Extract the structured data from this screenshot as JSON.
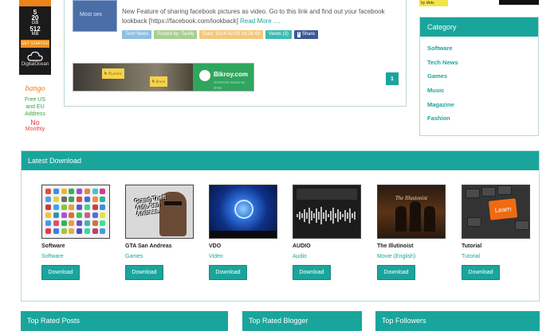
{
  "left_ad": {
    "do_specs": [
      "5",
      "20",
      "GB",
      "512",
      "MB"
    ],
    "do_button": "GET STARTED",
    "do_brand": "DigitalOcean",
    "bango_logo": "bango",
    "bango_lines": [
      "Free US",
      "and EU",
      "Address"
    ],
    "bango_big": "No",
    "bango_small": "Monthly"
  },
  "post": {
    "thumb_text": "Most sex",
    "excerpt": "New Feature of sharing facebook pictures as video. Go to this link and find out your facebook lookback [https://facebook.com/lookback]",
    "read_more": "Read More ....",
    "tags": {
      "category": "Tech News",
      "author": "Posted by: Taufiq",
      "date": "Date: 2014-02-05 16:28:49",
      "views": "Views (3)",
      "share": "Share",
      "share_icon": "f"
    },
    "bikroy": {
      "price1": "৳ ৩,০০০",
      "price2": "৳ ৫০০",
      "brand": "Bikroy.com",
      "tagline": "বাংলাদেশের সবচেয়ে বড় বাজার"
    },
    "page_number": "1"
  },
  "tads_label": "by tAds",
  "category": {
    "title": "Category",
    "items": [
      "Software",
      "Tech News",
      "Games",
      "Music",
      "Magazine",
      "Fashion"
    ]
  },
  "latest_download": {
    "title": "Latest Download",
    "button_label": "Download",
    "items": [
      {
        "title": "Software",
        "category": "Software"
      },
      {
        "title": "GTA San Andreas",
        "category": "Games"
      },
      {
        "title": "VDO",
        "category": "Video"
      },
      {
        "title": "AUDIO",
        "category": "Audio"
      },
      {
        "title": "The Illutinoist",
        "category": "Movie (English)"
      },
      {
        "title": "Tutorial",
        "category": "Tutorial"
      }
    ],
    "thumb_text": {
      "gta": "Grand Theft Auto San Andreas",
      "illusionist": "The Illusionist",
      "learn": "Learn"
    }
  },
  "bottom": {
    "top_rated_posts": "Top Rated Posts",
    "top_rated_blogger": "Top Rated Blogger",
    "top_followers": "Top Followers"
  },
  "colors": {
    "accent": "#1aa59c",
    "category_tag": "#8cbfe0",
    "author_tag": "#a8cf8e",
    "date_tag": "#f5c77a",
    "facebook": "#3b5998"
  }
}
